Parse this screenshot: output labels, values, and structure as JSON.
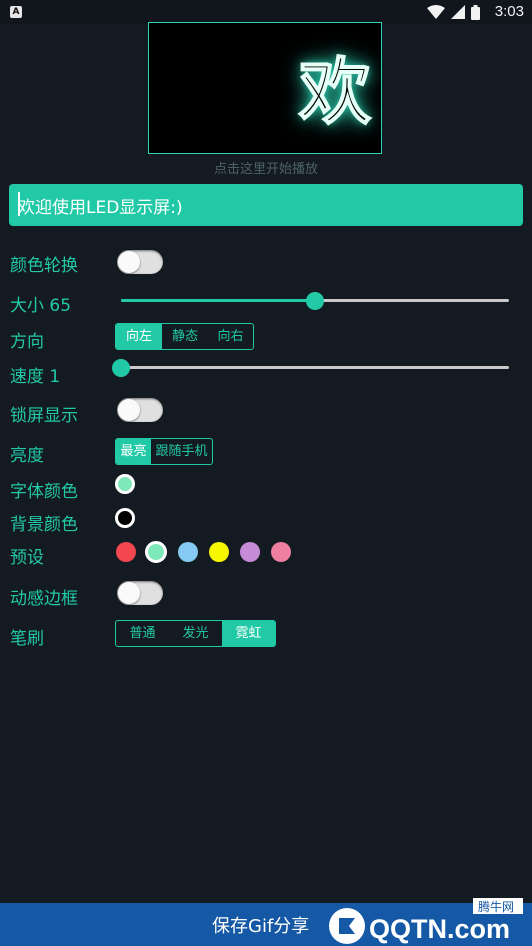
{
  "status_bar": {
    "app_badge": "A",
    "time": "3:03"
  },
  "preview": {
    "text": "欢",
    "hint": "点击这里开始播放"
  },
  "message_input": {
    "value": "欢迎使用LED显示屏:)"
  },
  "settings": {
    "color_cycle": {
      "label": "颜色轮换",
      "on": false
    },
    "size": {
      "label": "大小 65",
      "value": 65,
      "fraction": 0.5
    },
    "direction": {
      "label": "方向",
      "options": [
        "向左",
        "静态",
        "向右"
      ],
      "selected": "向左"
    },
    "speed": {
      "label": "速度 1",
      "value": 1,
      "fraction": 0.0
    },
    "lockscreen": {
      "label": "锁屏显示",
      "on": false
    },
    "brightness": {
      "label": "亮度",
      "options": [
        "最亮",
        "跟随手机"
      ],
      "selected": "最亮"
    },
    "font_color": {
      "label": "字体颜色",
      "color": "#7ee8b8"
    },
    "bg_color": {
      "label": "背景颜色",
      "color": "#000000"
    },
    "presets": {
      "label": "预设",
      "colors": [
        "#f2474f",
        "#7ee8b8",
        "#83cbf3",
        "#f7f700",
        "#c68bd6",
        "#ef7fa0"
      ],
      "selected_index": 1
    },
    "dynamic_border": {
      "label": "动感边框",
      "on": false
    },
    "brush": {
      "label": "笔刷",
      "options": [
        "普通",
        "发光",
        "霓虹"
      ],
      "selected": "霓虹"
    }
  },
  "bottom_bar": {
    "label": "保存Gif分享",
    "watermark_top": "腾牛网",
    "watermark_main": "QQTN.com"
  },
  "colors": {
    "accent": "#22c9a6",
    "background": "#141a22",
    "bottom_bar": "#1559a6"
  }
}
